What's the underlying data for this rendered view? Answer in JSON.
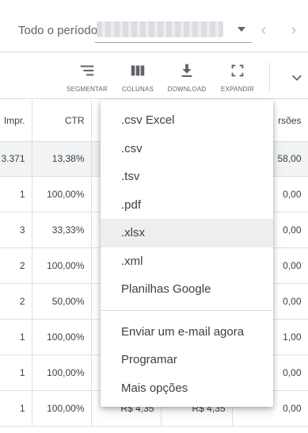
{
  "date_bar": {
    "label": "Todo o período",
    "prev_label": "‹",
    "next_label": "›"
  },
  "toolbar": {
    "segment_label": "SEGMENTAR",
    "columns_label": "COLUNAS",
    "download_label": "DOWNLOAD",
    "expand_label": "EXPANDIR"
  },
  "table": {
    "headers": [
      "Impr.",
      "CTR",
      "",
      "",
      "rsões"
    ],
    "total_row": [
      "3.371",
      "13,38%",
      "",
      "",
      "58,00"
    ],
    "rows": [
      [
        "1",
        "100,00%",
        "",
        "",
        "0,00"
      ],
      [
        "3",
        "33,33%",
        "",
        "",
        "0,00"
      ],
      [
        "2",
        "100,00%",
        "",
        "",
        "0,00"
      ],
      [
        "2",
        "50,00%",
        "",
        "",
        "0,00"
      ],
      [
        "1",
        "100,00%",
        "",
        "",
        "1,00"
      ],
      [
        "1",
        "100,00%",
        "",
        "",
        "0,00"
      ],
      [
        "1",
        "100,00%",
        "R$ 4,35",
        "R$ 4,35",
        "0,00"
      ]
    ]
  },
  "menu": {
    "download_items": [
      ".csv Excel",
      ".csv",
      ".tsv",
      ".pdf",
      ".xlsx",
      ".xml",
      "Planilhas Google"
    ],
    "action_items": [
      "Enviar um e-mail agora",
      "Programar",
      "Mais opções"
    ],
    "highlighted_item": ".xlsx"
  },
  "colors": {
    "icon": "#5f6368",
    "menu_highlight": "#eeeeee",
    "total_row_bg": "#f1f3f4"
  }
}
